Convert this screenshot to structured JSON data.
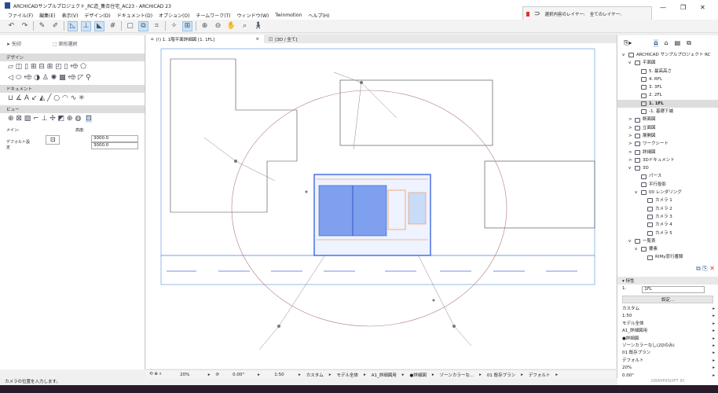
{
  "title": "ARCHICADサンプルプロジェクト_RC造_集合住宅_AC23 - ARCHICAD 23",
  "menu": [
    "ファイル(F)",
    "編集(E)",
    "表示(V)",
    "デザイン(D)",
    "ドキュメント(D)",
    "オプション(O)",
    "チームワーク(T)",
    "ウィンドウ(W)",
    "Twinmotion",
    "ヘルプ(H)"
  ],
  "layers": {
    "selected_label": "選択内容のレイヤー:",
    "all_label": "全てのレイヤー:"
  },
  "window_controls": [
    "—",
    "❐",
    "✕"
  ],
  "toolbox": {
    "arrow": "矢印",
    "marquee": "矩形選択",
    "sections": [
      "デザイン",
      "ドキュメント",
      "ビュー"
    ],
    "main_label": "メイン:",
    "height_label": "高度:",
    "default_label": "デフォルト設定",
    "height1": "3000.0",
    "height2": "3000.0"
  },
  "tabs": [
    {
      "label": "(!) 1. 1階平面詳細図 [1. 1FL]",
      "close": "×"
    },
    {
      "label": "[3D / 全て]"
    }
  ],
  "navigator": {
    "items": [
      {
        "label": "ARCHICAD サンプルプロジェクト RC",
        "level": 0,
        "arrow": "v"
      },
      {
        "label": "平面図",
        "level": 1,
        "arrow": "v"
      },
      {
        "label": "5. 最高高さ",
        "level": 2
      },
      {
        "label": "4. RFL",
        "level": 2
      },
      {
        "label": "3. 3FL",
        "level": 2
      },
      {
        "label": "2. 2FL",
        "level": 2
      },
      {
        "label": "1. 1FL",
        "level": 2,
        "selected": true
      },
      {
        "label": "-1. 基礎下端",
        "level": 2
      },
      {
        "label": "断面図",
        "level": 1,
        "arrow": ">"
      },
      {
        "label": "立面図",
        "level": 1,
        "arrow": ">"
      },
      {
        "label": "展開図",
        "level": 1,
        "arrow": ">"
      },
      {
        "label": "ワークシート",
        "level": 1,
        "arrow": ">"
      },
      {
        "label": "詳細図",
        "level": 1,
        "arrow": ">"
      },
      {
        "label": "3Dドキュメント",
        "level": 1,
        "arrow": ">"
      },
      {
        "label": "3D",
        "level": 1,
        "arrow": "v"
      },
      {
        "label": "パース",
        "level": 2
      },
      {
        "label": "平行投影",
        "level": 2
      },
      {
        "label": "00 レンダリング",
        "level": 2,
        "arrow": "v"
      },
      {
        "label": "カメラ 1",
        "level": 3
      },
      {
        "label": "カメラ 2",
        "level": 3
      },
      {
        "label": "カメラ 3",
        "level": 3
      },
      {
        "label": "カメラ 4",
        "level": 3
      },
      {
        "label": "カメラ 5",
        "level": 3
      },
      {
        "label": "一覧表",
        "level": 1,
        "arrow": "v"
      },
      {
        "label": "要素",
        "level": 2,
        "arrow": "v"
      },
      {
        "label": "RIMy窓行番録",
        "level": 3
      }
    ]
  },
  "properties": {
    "header": "特性",
    "id": "1.",
    "name": "1FL",
    "settings_button": "設定...",
    "rows": [
      "カスタム",
      "1:50",
      "モデル全体",
      "A1_詳細図用",
      "●詳細図",
      "ゾーンカラーなし(2Dのみ)",
      "01 既存プラン",
      "デフォルト",
      "20%",
      "0.00°"
    ],
    "brand": "GRAPHISOFT ID"
  },
  "bottombar": {
    "zoom": "20%",
    "angle": "0.00°",
    "scale": "1:50",
    "structure": "カスタム",
    "model": "モデル全体",
    "pen": "A1_詳細図用",
    "mvo": "●詳細図",
    "zone": "ゾーンカラーな...",
    "renovation": "01 既存プラン",
    "dim": "デフォルト"
  },
  "status": "カメラの位置を入力します。",
  "colors": {
    "accent": "#1f4fd8",
    "arc": "#b07878",
    "highlight": "#cfe3f7"
  }
}
